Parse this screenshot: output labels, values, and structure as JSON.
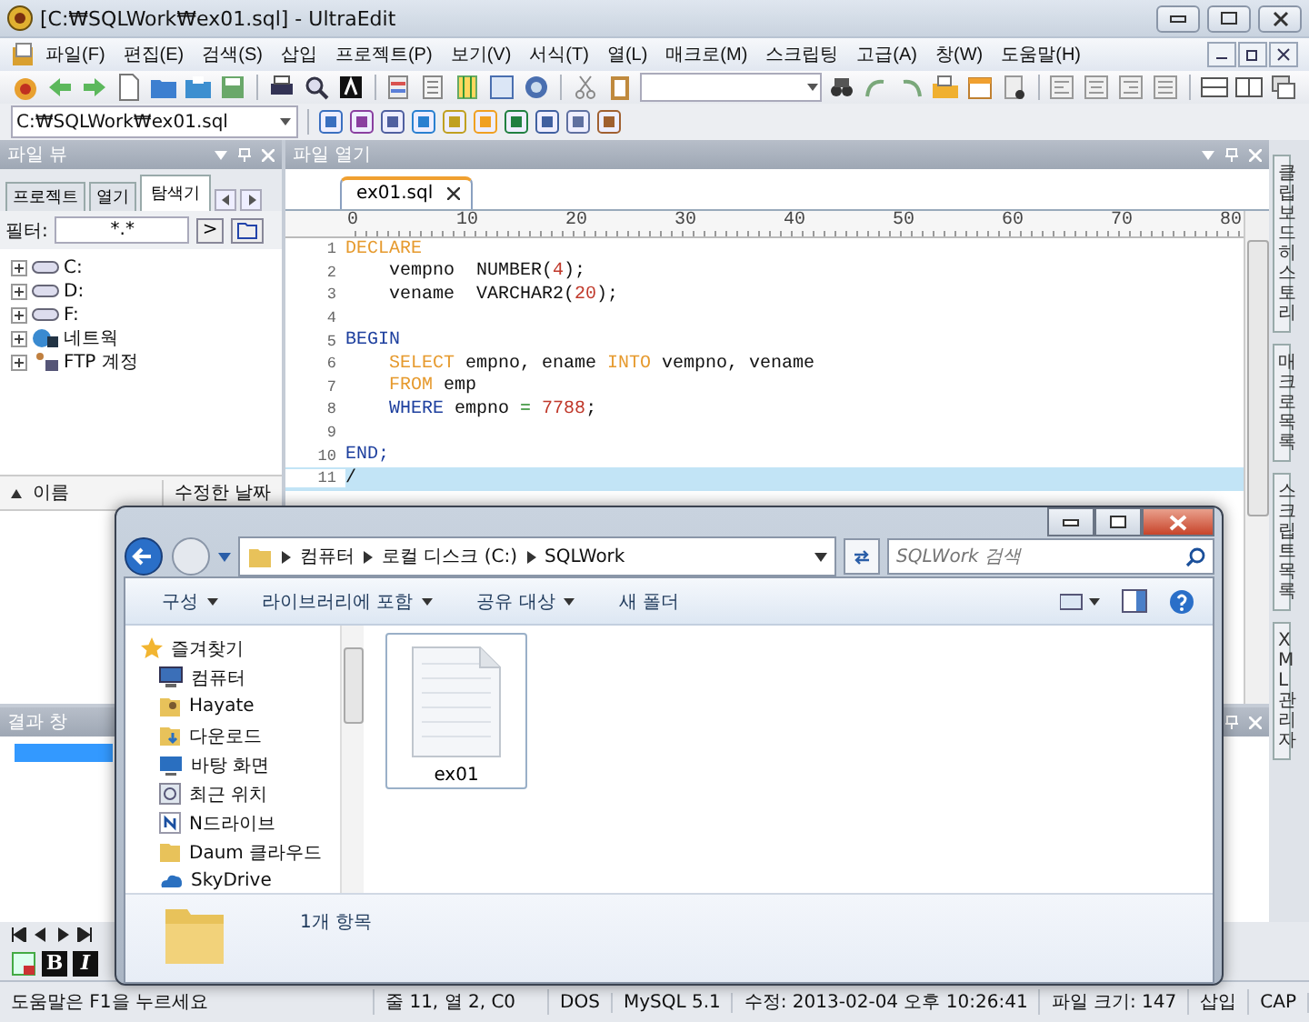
{
  "window": {
    "title": "[C:₩SQLWork₩ex01.sql] - UltraEdit"
  },
  "menu": [
    "파일(F)",
    "편집(E)",
    "검색(S)",
    "삽입",
    "프로젝트(P)",
    "보기(V)",
    "서식(T)",
    "열(L)",
    "매크로(M)",
    "스크립팅",
    "고급(A)",
    "창(W)",
    "도움말(H)"
  ],
  "path_combo": {
    "value": "C:₩SQLWork₩ex01.sql"
  },
  "file_view": {
    "title": "파일 뷰",
    "tabs": [
      {
        "label": "프로젝트",
        "selected": false
      },
      {
        "label": "열기",
        "selected": false
      },
      {
        "label": "탐색기",
        "selected": true
      }
    ],
    "filter_label": "필터:",
    "filter_value": "*.*",
    "filter_button": ">",
    "tree": [
      {
        "label": "C:",
        "kind": "drive"
      },
      {
        "label": "D:",
        "kind": "drive"
      },
      {
        "label": "F:",
        "kind": "drive"
      },
      {
        "label": "네트웍",
        "kind": "network"
      },
      {
        "label": "FTP 계정",
        "kind": "ftp"
      }
    ],
    "columns": [
      "이름",
      "수정한 날짜"
    ]
  },
  "editor": {
    "panel_title": "파일 열기",
    "tabs": [
      {
        "label": "ex01.sql",
        "selected": true
      }
    ],
    "ruler": [
      "0",
      "10",
      "20",
      "30",
      "40",
      "50",
      "60",
      "70",
      "80"
    ],
    "lines": [
      {
        "number": "1",
        "current": false,
        "tokens": [
          {
            "text": "DECLARE",
            "kind": "keyword"
          }
        ]
      },
      {
        "number": "2",
        "current": false,
        "indented": true,
        "tokens": [
          {
            "text": "vempno  NUMBER(",
            "kind": "plain"
          },
          {
            "text": "4",
            "kind": "number"
          },
          {
            "text": ");",
            "kind": "plain"
          }
        ]
      },
      {
        "number": "3",
        "current": false,
        "indented": true,
        "tokens": [
          {
            "text": "vename  VARCHAR2(",
            "kind": "plain"
          },
          {
            "text": "20",
            "kind": "number"
          },
          {
            "text": ");",
            "kind": "plain"
          }
        ]
      },
      {
        "number": "4",
        "current": false
      },
      {
        "number": "5",
        "current": false,
        "tokens": [
          {
            "text": "BEGIN",
            "kind": "block"
          }
        ]
      },
      {
        "number": "6",
        "current": false,
        "indented": true,
        "tokens": [
          {
            "text": "SELECT",
            "kind": "keyword"
          },
          {
            "text": " empno, ename ",
            "kind": "plain"
          },
          {
            "text": "INTO",
            "kind": "keyword"
          },
          {
            "text": " vempno, vename",
            "kind": "plain"
          }
        ]
      },
      {
        "number": "7",
        "current": false,
        "indented": true,
        "tokens": [
          {
            "text": "FROM",
            "kind": "keyword"
          },
          {
            "text": " emp",
            "kind": "plain"
          }
        ]
      },
      {
        "number": "8",
        "current": false,
        "indented": true,
        "tokens": [
          {
            "text": "WHERE",
            "kind": "block"
          },
          {
            "text": " empno ",
            "kind": "plain"
          },
          {
            "text": "= ",
            "kind": "operator"
          },
          {
            "text": "7788",
            "kind": "number"
          },
          {
            "text": ";",
            "kind": "plain"
          }
        ]
      },
      {
        "number": "9",
        "current": false
      },
      {
        "number": "10",
        "current": false,
        "tokens": [
          {
            "text": "END;",
            "kind": "block"
          }
        ]
      },
      {
        "number": "11",
        "current": true,
        "tokens": [
          {
            "text": "/",
            "kind": "plain"
          }
        ]
      }
    ]
  },
  "side_tabs": [
    "클립보드 히스토리",
    "매크로 목록",
    "스크립트 목록",
    "XML 관리자"
  ],
  "results": {
    "title": "결과 창"
  },
  "format_buttons": [
    "B",
    "I"
  ],
  "explorer": {
    "breadcrumb": [
      "컴퓨터",
      "로컬 디스크 (C:)",
      "SQLWork"
    ],
    "search_placeholder": "SQLWork 검색",
    "commands": [
      {
        "label": "구성",
        "dropdown": true
      },
      {
        "label": "라이브러리에 포함",
        "dropdown": true
      },
      {
        "label": "공유 대상",
        "dropdown": true
      },
      {
        "label": "새 폴더",
        "dropdown": false
      }
    ],
    "nav": [
      {
        "label": "즐겨찾기",
        "kind": "star"
      },
      {
        "label": "컴퓨터",
        "kind": "computer"
      },
      {
        "label": "Hayate",
        "kind": "user"
      },
      {
        "label": "다운로드",
        "kind": "download"
      },
      {
        "label": "바탕 화면",
        "kind": "desktop"
      },
      {
        "label": "최근 위치",
        "kind": "recent"
      },
      {
        "label": "N드라이브",
        "kind": "ndrive"
      },
      {
        "label": "Daum 클라우드",
        "kind": "folder"
      },
      {
        "label": "SkyDrive",
        "kind": "cloud"
      }
    ],
    "files": [
      {
        "name": "ex01",
        "selected": true
      }
    ],
    "status": "1개 항목"
  },
  "status_bar": [
    "도움말은 F1을 누르세요",
    "줄 11, 열 2, C0",
    "DOS",
    "MySQL 5.1",
    "수정: 2013-02-04 오후 10:26:41",
    "파일 크기: 147",
    "삽입",
    "CAP"
  ]
}
